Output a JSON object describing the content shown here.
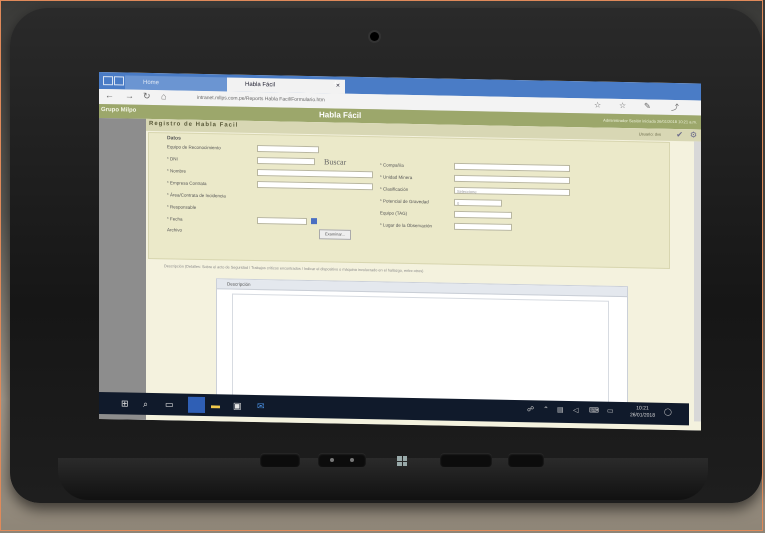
{
  "browser": {
    "tab_inactive": "Home",
    "tab_active": "Habla Fácil",
    "tab_close": "×",
    "new_tab": "+",
    "url": "intranet.mllps.com.pe/Reports Habla Facil/Formulario.htm"
  },
  "app": {
    "org_name": "Grupo Milpo",
    "title": "Habla Fácil",
    "user_info": "Administrador  Sesión iniciada 26/01/2018 10:21 a.m."
  },
  "main": {
    "heading": "Registro de Habla Facil",
    "header_right": "Usuario: dvs"
  },
  "form": {
    "section_label": "Datos",
    "left_labels": [
      "Equipo de Reconocimiento",
      "* DNI",
      "* Nombre",
      "* Empresa Contrata",
      "* Área/Contrata de Incidencia",
      "* Responsable",
      "* Fecha",
      "Archivo"
    ],
    "buscar_label": "Buscar",
    "examinar_label": "Examinar...",
    "right_labels": [
      "* Compañía",
      "* Unidad Minera",
      "* Clasificación",
      "* Potencial de Gravedad",
      "Equipo (TAG)",
      "* Lugar de la Observación"
    ],
    "clasificacion_value": "Seleccione",
    "potencial_value": "0"
  },
  "description": {
    "hint": "Descripción (Detalles: Sobre el acto de Seguridad / Trabajos críticos encontrados / Indicar el dispositivo o máquina involucrado en el hallazgo, entre otros)",
    "box_title": "Descripción"
  },
  "taskbar": {
    "start_icon": "windows-start-icon",
    "search_icon": "search-icon",
    "time": "10:21",
    "date": "26/01/2018"
  },
  "colors": {
    "app_header": "#9ca76b",
    "form_bg": "#ebe9c9",
    "browser_tab": "#4a7cc6",
    "taskbar": "#101a2b"
  }
}
